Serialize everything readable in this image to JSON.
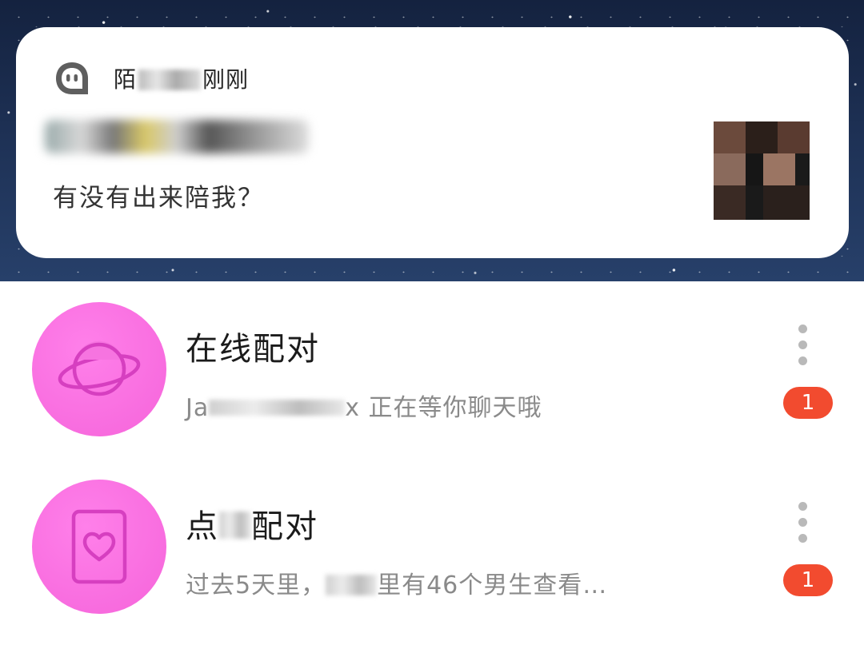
{
  "notification": {
    "app_name_prefix": "陌",
    "time": "刚刚",
    "message": "有没有出来陪我？",
    "app_icon": "momo-app-icon"
  },
  "matches": [
    {
      "title": "在线配对",
      "subtitle_prefix": "Ja",
      "subtitle_suffix": "x 正在等你聊天哦",
      "icon": "planet-icon",
      "badge": "1"
    },
    {
      "title_prefix": "点",
      "title_suffix": "配对",
      "subtitle_prefix": "过去5天里，",
      "subtitle_suffix": "里有46个男生查看…",
      "icon": "heart-card-icon",
      "badge": "1"
    }
  ],
  "colors": {
    "accent_pink": "#f564da",
    "badge_red": "#f24b2f",
    "sky": "#1f3358"
  }
}
